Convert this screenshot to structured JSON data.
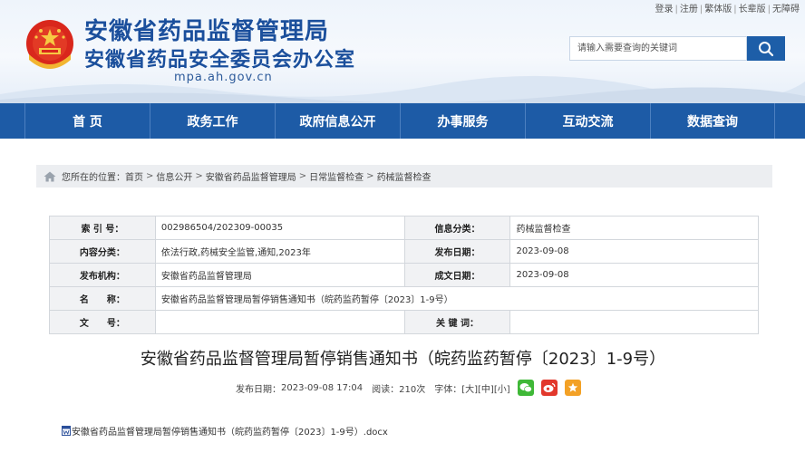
{
  "site": {
    "title_line1": "安徽省药品监督管理局",
    "title_line2": "安徽省药品安全委员会办公室",
    "domain": "mpa.ah.gov.cn",
    "brand_color": "#1d5ba6"
  },
  "toplinks": [
    "登录",
    "注册",
    "繁体版",
    "长辈版",
    "无障碍"
  ],
  "search": {
    "placeholder": "请输入需要查询的关键词"
  },
  "nav": [
    "首 页",
    "政务工作",
    "政府信息公开",
    "办事服务",
    "互动交流",
    "数据查询"
  ],
  "breadcrumb": {
    "prefix": "您所在的位置：",
    "items": [
      "首页",
      "信息公开",
      "安徽省药品监督管理局",
      "日常监督检查",
      "药械监督检查"
    ]
  },
  "info_table": {
    "rows": [
      {
        "k1": "索 引 号：",
        "v1": "002986504/202309-00035",
        "k2": "信息分类：",
        "v2": "药械监督检查"
      },
      {
        "k1": "内容分类：",
        "v1": "依法行政,药械安全监管,通知,2023年",
        "k2": "发布日期：",
        "v2": "2023-09-08"
      },
      {
        "k1": "发布机构：",
        "v1": "安徽省药品监督管理局",
        "k2": "成文日期：",
        "v2": "2023-09-08"
      }
    ],
    "name_label": "名　　称：",
    "name_value": "安徽省药品监督管理局暂停销售通知书（皖药监药暂停〔2023〕1-9号）",
    "last_row": {
      "k1": "文　　号：",
      "v1": "",
      "k2": "关 键 词：",
      "v2": ""
    }
  },
  "article": {
    "title": "安徽省药品监督管理局暂停销售通知书（皖药监药暂停〔2023〕1-9号）",
    "date_label": "发布日期：",
    "date": "2023-09-08 17:04",
    "views_label": "阅读：",
    "views": "210次",
    "font_label": "字体：",
    "font_large": "[大]",
    "font_medium": "[中]",
    "font_small": "[小]",
    "share_icons": [
      "wechat-icon",
      "weibo-icon",
      "favorite-icon"
    ]
  },
  "attachment": {
    "filename": "安徽省药品监督管理局暂停销售通知书（皖药监药暂停〔2023〕1-9号）.docx"
  }
}
